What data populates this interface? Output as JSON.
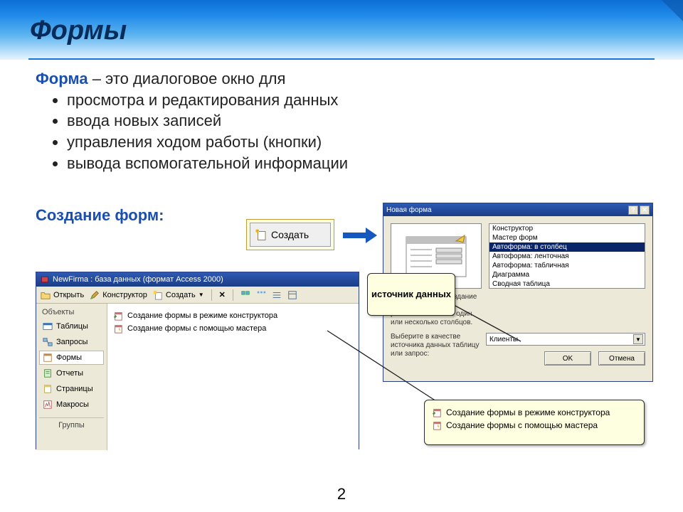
{
  "slide": {
    "title": "Формы",
    "term": "Форма",
    "definition_tail": " – это диалоговое окно для",
    "bullets": [
      "просмотра и редактирования данных",
      "ввода новых записей",
      "управления ходом работы (кнопки)",
      "вывода вспомогательной информации"
    ],
    "subhead": "Создание форм:",
    "page_number": "2"
  },
  "create_button": {
    "label": "Создать"
  },
  "access_window": {
    "title": "NewFirma : база данных (формат Access 2000)",
    "toolbar": {
      "open": "Открыть",
      "design": "Конструктор",
      "create": "Создать"
    },
    "sidebar": {
      "header": "Объекты",
      "items": [
        "Таблицы",
        "Запросы",
        "Формы",
        "Отчеты",
        "Страницы",
        "Макросы"
      ],
      "groups": "Группы",
      "selected_index": 2
    },
    "main_items": [
      "Создание формы в режиме конструктора",
      "Создание формы с помощью мастера"
    ]
  },
  "new_form_dialog": {
    "title": "Новая форма",
    "options": [
      "Конструктор",
      "Мастер форм",
      "Автоформа: в столбец",
      "Автоформа: ленточная",
      "Автоформа: табличная",
      "Диаграмма",
      "Сводная таблица"
    ],
    "selected_index": 2,
    "description": "Автоматическое создание форм с полями, расположенными в один или несколько столбцов.",
    "source_label": "Выберите в качестве источника данных таблицу или запрос:",
    "source_value": "Клиенты",
    "ok": "OK",
    "cancel": "Отмена"
  },
  "callouts": {
    "source": "источник данных",
    "form_creation_items": [
      "Создание формы в режиме конструктора",
      "Создание формы с помощью мастера"
    ]
  }
}
